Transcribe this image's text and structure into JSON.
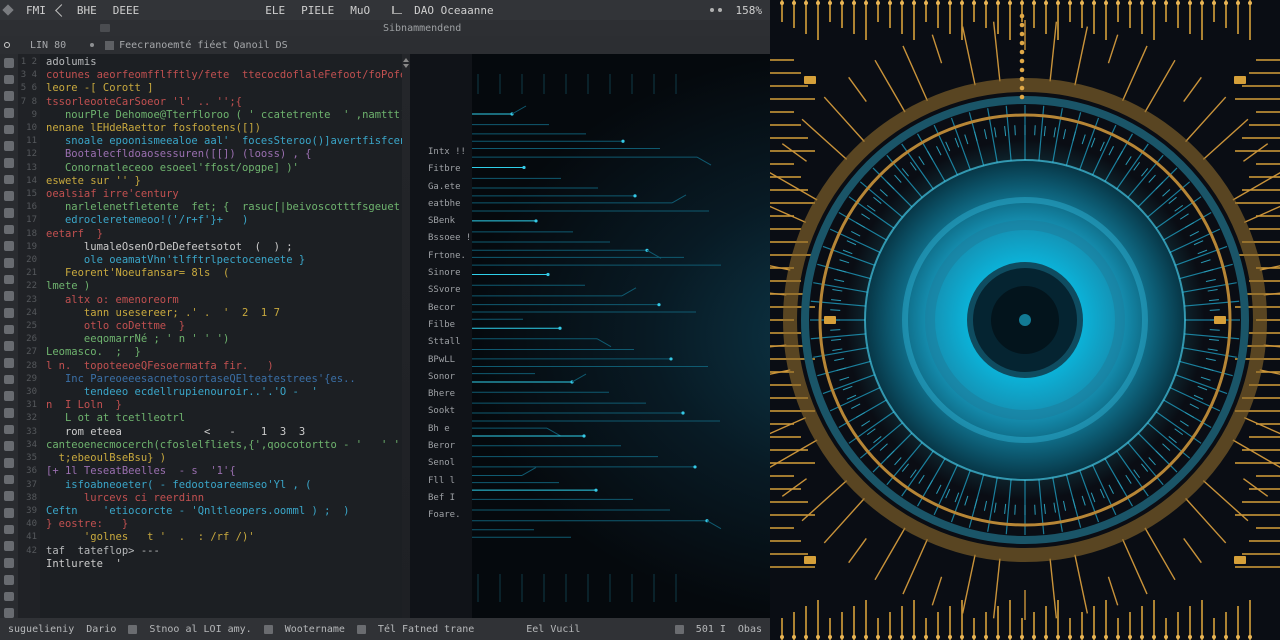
{
  "menu": {
    "back_icon": "chevron-left-icon",
    "items": [
      "FMI",
      "BHE",
      "DEEE"
    ],
    "mid": [
      "ELE",
      "PIELE",
      "MuO"
    ],
    "right_icon": "chart-icon",
    "right_label": "DAO Oceaanne",
    "zoom": "158%"
  },
  "sub_bar": {
    "label": "Sibnammendend"
  },
  "path": {
    "lncol": "LIN 80",
    "file": "Feecranoemté fiéet Qanoil DS"
  },
  "activity_icons": [
    "menu-icon",
    "files-icon",
    "search-icon",
    "branch-icon",
    "debug-icon",
    "extensions-icon",
    "circle-icon",
    "square-icon",
    "play-icon",
    "gear-icon",
    "shield-icon",
    "terminal-icon",
    "bell-icon",
    "user-icon",
    "clock-icon",
    "tag-icon",
    "bookmark-icon",
    "database-icon",
    "link-icon",
    "refresh-icon",
    "download-icon",
    "upload-icon",
    "lock-icon",
    "key-icon",
    "folder-icon",
    "file-icon",
    "image-icon",
    "video-icon",
    "inbox-icon",
    "flag-icon",
    "star-icon",
    "heart-icon",
    "pin-icon",
    "target-icon"
  ],
  "code": [
    {
      "indent": 0,
      "cls": "c-pl",
      "t": "adolumis"
    },
    {
      "indent": 0,
      "cls": "c-kw",
      "t": "cotunes aeorfeomfflfftly/fete  ttecocdoflaleFefoot/foPofeflamtfun"
    },
    {
      "indent": 0,
      "cls": "c-fn",
      "t": "leore -[ Corott ]"
    },
    {
      "indent": 0,
      "cls": "c-kw",
      "t": "tssorleooteCarSoeor 'l' .. '';{"
    },
    {
      "indent": 1,
      "cls": "c-var",
      "t": "nourPle Dehomoe@Tterfloroo ( ' ccatetrente  ' ,namttt) }"
    },
    {
      "indent": 0,
      "cls": "c-fn",
      "t": "nenane lEHdeRaettor fosfootens([])"
    },
    {
      "indent": 1,
      "cls": "c-str",
      "t": "snoale epoonismeealoe aal'  focesSteroo()]avertfisfcene([-.."
    },
    {
      "indent": 1,
      "cls": "c-op",
      "t": "Bootalecfldoaosessuren([[]) (looss) , {"
    },
    {
      "indent": 1,
      "cls": "c-var",
      "t": "Conornatleceoo esoeel'ffost/opgpe] )'"
    },
    {
      "indent": 0,
      "cls": "c-fn",
      "t": "eswete sur '' }"
    },
    {
      "indent": 0,
      "cls": "c-kw",
      "t": "oealsiaf irre'century"
    },
    {
      "indent": 1,
      "cls": "c-var",
      "t": "narlelenetfletente  fet; {  rasuc[|beivoscotttfsgeuet' -{"
    },
    {
      "indent": 1,
      "cls": "c-str",
      "t": "edrocleretemeoo!('/r+f'}+   )"
    },
    {
      "indent": 0,
      "cls": "c-kw",
      "t": "eetarf  }"
    },
    {
      "indent": 2,
      "cls": "c-wh",
      "t": "lumaleOsenOrDeDefeetsotot  (  ) ;"
    },
    {
      "indent": 2,
      "cls": "c-str",
      "t": "ole oeamatVhn'tlfftrlpectoceneete }"
    },
    {
      "indent": 1,
      "cls": "c-fn",
      "t": "Feorent'Noeufansar= 8ls  ("
    },
    {
      "indent": 0,
      "cls": "c-var",
      "t": "lmete )"
    },
    {
      "indent": 1,
      "cls": "c-kw",
      "t": "altx o: emenoreorm"
    },
    {
      "indent": 2,
      "cls": "c-fn",
      "t": "tann usesereer; .' .  '  2  1 7"
    },
    {
      "indent": 2,
      "cls": "c-kw",
      "t": "otlo coDettme  }"
    },
    {
      "indent": 2,
      "cls": "c-var",
      "t": "eeqomarrNé ; ' n ' ' ')"
    },
    {
      "indent": 0,
      "cls": "c-var",
      "t": "Leomasco.  ;  }"
    },
    {
      "indent": 0,
      "cls": "c-kw",
      "t": "l n.  topoteeoeQFesoermatfa fir.   )"
    },
    {
      "indent": 1,
      "cls": "c-cm",
      "t": "Inc PareoeeesacnetosortaseQElteatestrees'{es.."
    },
    {
      "indent": 2,
      "cls": "c-str",
      "t": "tendeeo ecdellrupienouroir..'.'O -  '"
    },
    {
      "indent": 0,
      "cls": "c-kw",
      "t": "n  I Loln  }"
    },
    {
      "indent": 1,
      "cls": "c-var",
      "t": "L ot at tcetlleotrl"
    },
    {
      "indent": 1,
      "cls": "c-wh",
      "t": "rom eteea             <   -    1  3  3"
    },
    {
      "indent": 0,
      "cls": "c-var",
      "t": "canteoenecmocerch(cfoslelfliets,{',qoocotortto - '   ' '"
    },
    {
      "indent": 0,
      "cls": "c-fn",
      "t": "  t;ebeoulBseBsu} )"
    },
    {
      "indent": 0,
      "cls": "c-op",
      "t": "[+ 1l TeseatBeelles  - s  '1'{"
    },
    {
      "indent": 1,
      "cls": "c-str",
      "t": "isfoabneoeter( - fedootoareemseo'Yl , ("
    },
    {
      "indent": 2,
      "cls": "c-kw",
      "t": "lurcevs ci reerdinn"
    },
    {
      "indent": 0,
      "cls": "c-str",
      "t": "Ceftn    'etiocorcte - 'Qnltleopers.oomml ) ;  )"
    },
    {
      "indent": 0,
      "cls": "c-kw",
      "t": "} eostre:   }"
    },
    {
      "indent": 2,
      "cls": "c-fn",
      "t": "'golnes   t '  .  : /rf /)'"
    },
    {
      "indent": 0,
      "cls": "c-pl",
      "t": "taf  tateflop> ---"
    },
    {
      "indent": 0,
      "cls": "c-wh",
      "t": "Intlurete  '"
    }
  ],
  "labels": [
    "Intx !!",
    "Fitbre",
    "Ga.ete",
    "eatbhe",
    "SBenk",
    "Bssoee !",
    "Frtone.",
    "Sinore",
    "SSvore",
    "Becor",
    "Filbe",
    "Sttall",
    "BPwLL",
    "Sonor",
    "Bhere",
    "Sookt",
    "Bh e",
    "Beror",
    "Senol",
    "Fll l",
    "Bef  I",
    "Foare."
  ],
  "status": {
    "left1": "suguelieniy",
    "left2": "Dario",
    "left3": "Stnoo al  LOI amy.",
    "left4": "Wootername",
    "left5": "Tél Fatned trane",
    "mid": "Eel Vucil",
    "right1": "501 I",
    "right2": "Obas"
  }
}
